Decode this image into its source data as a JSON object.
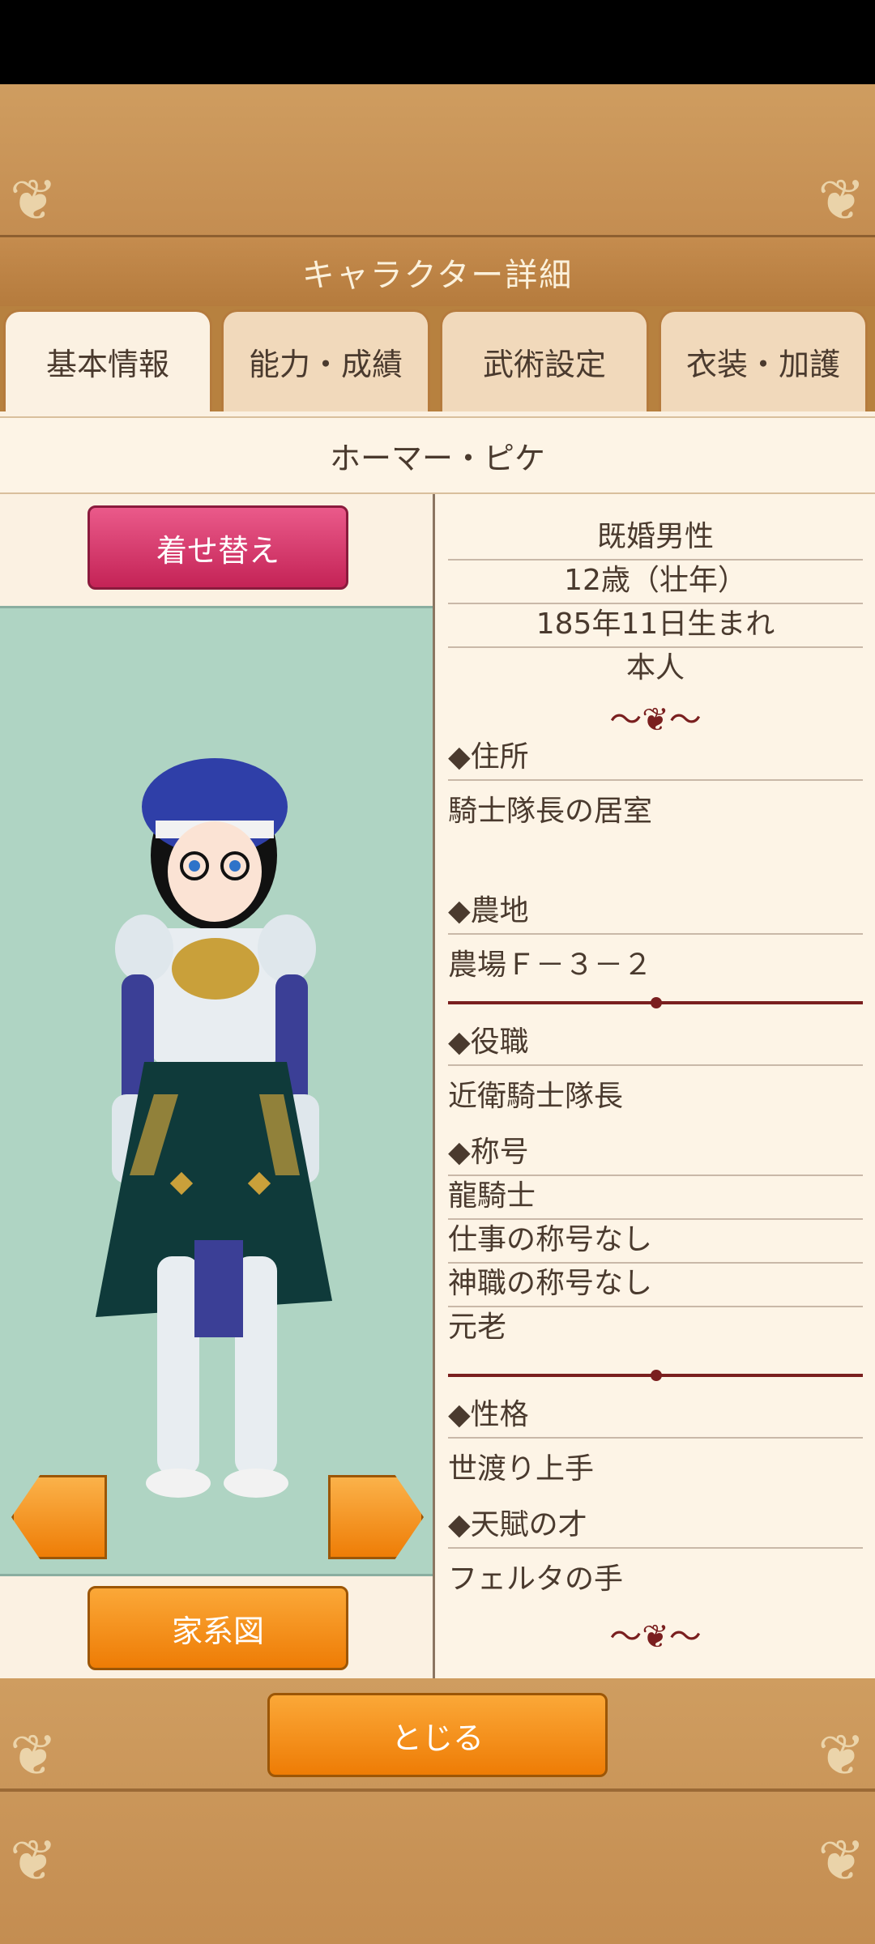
{
  "header": {
    "title": "キャラクター詳細"
  },
  "tabs": [
    {
      "label": "基本情報",
      "active": true
    },
    {
      "label": "能力・成績",
      "active": false
    },
    {
      "label": "武術設定",
      "active": false
    },
    {
      "label": "衣装・加護",
      "active": false
    }
  ],
  "character": {
    "name": "ホーマー・ピケ"
  },
  "buttons": {
    "dress_up": "着せ替え",
    "family_tree": "家系図",
    "close": "とじる"
  },
  "summary": [
    "既婚男性",
    "12歳（壮年）",
    "185年11日生まれ",
    "本人"
  ],
  "sections": {
    "address": {
      "label": "◆住所",
      "value": "騎士隊長の居室"
    },
    "farm": {
      "label": "◆農地",
      "value": "農場Ｆ－３－２"
    },
    "role": {
      "label": "◆役職",
      "value": "近衛騎士隊長"
    },
    "titles": {
      "label": "◆称号",
      "values": [
        "龍騎士",
        "仕事の称号なし",
        "神職の称号なし",
        "元老"
      ]
    },
    "personality": {
      "label": "◆性格",
      "value": "世渡り上手"
    },
    "talent": {
      "label": "◆天賦の才",
      "value": "フェルタの手"
    }
  },
  "colors": {
    "accent_pink": "#d63a6e",
    "accent_orange": "#f38c14",
    "wood": "#c8955a",
    "panel_bg": "#fbf1e2",
    "viewer_bg": "#afd4c3",
    "ornament_red": "#7a1f1f"
  },
  "icons": [
    "left-arrow-icon",
    "right-arrow-icon",
    "scroll-ornament-icon"
  ]
}
